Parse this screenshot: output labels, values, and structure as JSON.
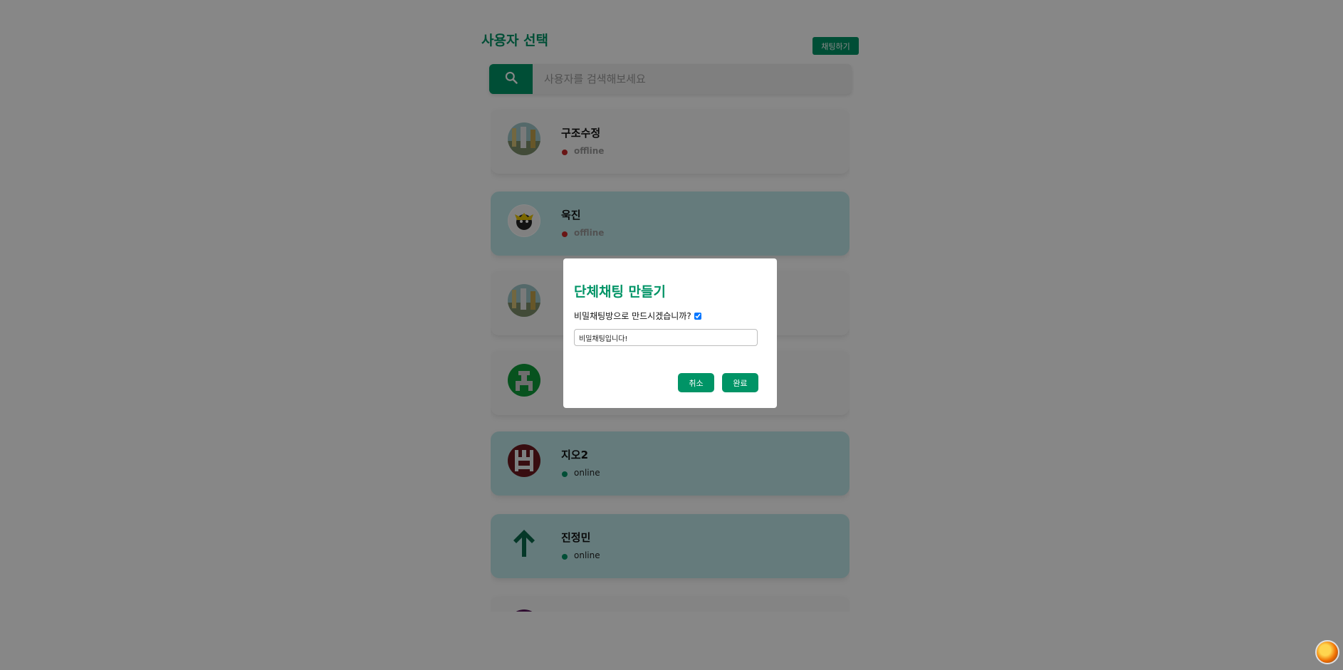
{
  "header": {
    "title": "사용자 선택",
    "chat_button_label": "채팅하기"
  },
  "search": {
    "placeholder": "사용자를 검색해보세요",
    "icon": "search-icon"
  },
  "users": [
    {
      "name": "구조수정",
      "status": "offline",
      "selected": false,
      "avatar": "photo-avatar"
    },
    {
      "name": "욱진",
      "status": "offline",
      "selected": true,
      "avatar": "cartoon-avatar"
    },
    {
      "name": "",
      "status": "",
      "selected": false,
      "avatar": "photo-avatar"
    },
    {
      "name": "",
      "status": "",
      "selected": false,
      "avatar": "pixel-avatar-green"
    },
    {
      "name": "지오2",
      "status": "online",
      "selected": true,
      "avatar": "pixel-avatar-maroon"
    },
    {
      "name": "진정민",
      "status": "online",
      "selected": true,
      "avatar": "arrow-up-avatar"
    }
  ],
  "modal": {
    "title": "단체채팅 만들기",
    "secret_question": "비밀채팅방으로 만드시겠습니까?",
    "secret_checked": true,
    "secret_input_value": "비밀채팅입니다!",
    "cancel_label": "취소",
    "confirm_label": "완료"
  },
  "colors": {
    "accent": "#009466",
    "selected_card": "#bfe9ea",
    "offline_dot": "#c62828",
    "online_dot": "#009466",
    "overlay": "rgba(0,0,0,0.47)"
  }
}
